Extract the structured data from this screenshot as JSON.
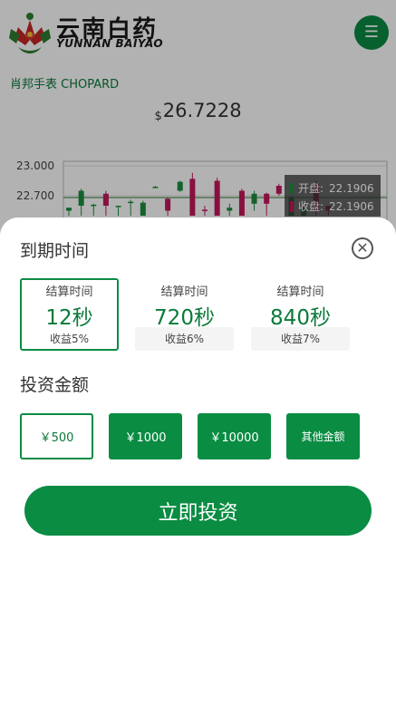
{
  "header": {
    "logo_cn": "云南白药",
    "logo_en": "YUNNAN BAIYAO",
    "menu_icon": "hamburger-menu-icon"
  },
  "product": {
    "name": "肖邦手表 CHOPARD"
  },
  "price": {
    "currency": "$",
    "value": "26.7228"
  },
  "chart": {
    "y_ticks": [
      "23.000",
      "22.700"
    ],
    "tooltip": {
      "open_label": "开盘:",
      "open_value": "22.1906",
      "close_label": "收盘:",
      "close_value": "22.1906"
    }
  },
  "chart_data": {
    "type": "candlestick",
    "ylim": [
      22.45,
      23.05
    ],
    "y_ticks": [
      23.0,
      22.7
    ],
    "up_color": "#1a8f3c",
    "down_color": "#c2185b",
    "candles": [
      {
        "open": 22.55,
        "close": 22.58,
        "high": 22.58,
        "low": 22.5,
        "dir": "up"
      },
      {
        "open": 22.6,
        "close": 22.75,
        "high": 22.77,
        "low": 22.5,
        "dir": "up"
      },
      {
        "open": 22.6,
        "close": 22.61,
        "high": 22.62,
        "low": 22.5,
        "dir": "up"
      },
      {
        "open": 22.6,
        "close": 22.72,
        "high": 22.75,
        "low": 22.5,
        "dir": "down"
      },
      {
        "open": 22.59,
        "close": 22.6,
        "high": 22.6,
        "low": 22.5,
        "dir": "up"
      },
      {
        "open": 22.63,
        "close": 22.64,
        "high": 22.66,
        "low": 22.5,
        "dir": "up"
      },
      {
        "open": 22.5,
        "close": 22.63,
        "high": 22.65,
        "low": 22.5,
        "dir": "up"
      },
      {
        "open": 22.78,
        "close": 22.79,
        "high": 22.8,
        "low": 22.78,
        "dir": "up"
      },
      {
        "open": 22.55,
        "close": 22.67,
        "high": 22.68,
        "low": 22.5,
        "dir": "down"
      },
      {
        "open": 22.75,
        "close": 22.84,
        "high": 22.85,
        "low": 22.74,
        "dir": "up"
      },
      {
        "open": 22.5,
        "close": 22.87,
        "high": 22.93,
        "low": 22.5,
        "dir": "down"
      },
      {
        "open": 22.55,
        "close": 22.56,
        "high": 22.6,
        "low": 22.5,
        "dir": "down"
      },
      {
        "open": 22.5,
        "close": 22.85,
        "high": 22.88,
        "low": 22.5,
        "dir": "down"
      },
      {
        "open": 22.55,
        "close": 22.58,
        "high": 22.62,
        "low": 22.5,
        "dir": "up"
      },
      {
        "open": 22.5,
        "close": 22.75,
        "high": 22.77,
        "low": 22.5,
        "dir": "down"
      },
      {
        "open": 22.62,
        "close": 22.72,
        "high": 22.75,
        "low": 22.55,
        "dir": "up"
      },
      {
        "open": 22.62,
        "close": 22.72,
        "high": 22.73,
        "low": 22.5,
        "dir": "down"
      },
      {
        "open": 22.72,
        "close": 22.8,
        "high": 22.82,
        "low": 22.7,
        "dir": "down"
      },
      {
        "open": 22.5,
        "close": 22.68,
        "high": 22.7,
        "low": 22.5,
        "dir": "up"
      },
      {
        "open": 22.5,
        "close": 22.58,
        "high": 22.6,
        "low": 22.5,
        "dir": "up"
      },
      {
        "open": 22.55,
        "close": 22.82,
        "high": 22.85,
        "low": 22.5,
        "dir": "down"
      },
      {
        "open": 22.55,
        "close": 22.6,
        "high": 22.6,
        "low": 22.5,
        "dir": "down"
      }
    ]
  },
  "sheet": {
    "title": "到期时间",
    "close_icon": "close-circle-icon",
    "durations": [
      {
        "label": "结算时间",
        "value": "12秒",
        "rate": "收益5%",
        "selected": true
      },
      {
        "label": "结算时间",
        "value": "720秒",
        "rate": "收益6%",
        "selected": false
      },
      {
        "label": "结算时间",
        "value": "840秒",
        "rate": "收益7%",
        "selected": false
      }
    ],
    "amount_title": "投资金额",
    "amounts": [
      {
        "label": "￥500",
        "selected": true
      },
      {
        "label": "￥1000",
        "selected": false
      },
      {
        "label": "￥10000",
        "selected": false
      },
      {
        "label": "其他金额",
        "selected": false
      }
    ],
    "invest_button": "立即投资"
  },
  "colors": {
    "accent": "#0a8c43",
    "accent_text": "#0a7a3a"
  }
}
